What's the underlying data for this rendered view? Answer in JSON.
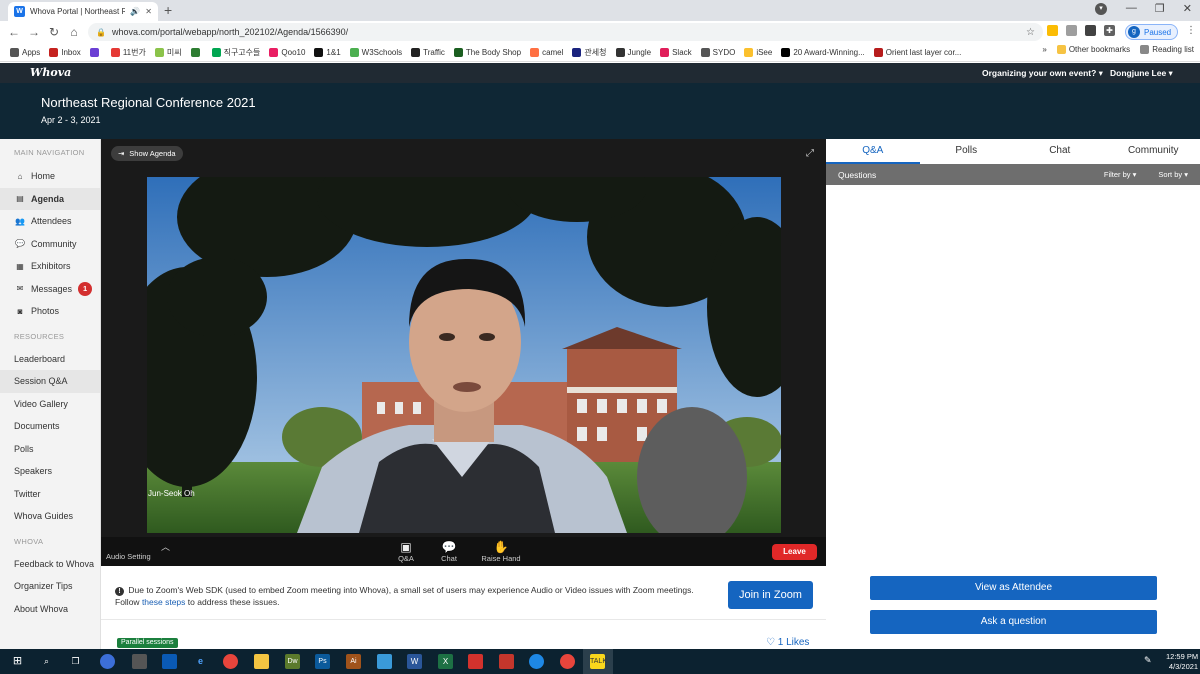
{
  "browser": {
    "tab_title": "Whova Portal | Northeast Regional Conference",
    "tab_favicon": "W",
    "url": "whova.com/portal/webapp/north_202102/Agenda/1566390/",
    "profile_initial": "g",
    "profile_status": "Paused",
    "bookmarks": [
      {
        "label": "Apps",
        "color": "#555"
      },
      {
        "label": "Inbox",
        "color": "#c5221f"
      },
      {
        "label": "",
        "color": "#6b3fd4"
      },
      {
        "label": "11번가",
        "color": "#e53935"
      },
      {
        "label": "미씨",
        "color": "#8bc34a"
      },
      {
        "label": "",
        "color": "#2e7d32"
      },
      {
        "label": "직구고수들",
        "color": "#00a651"
      },
      {
        "label": "Qoo10",
        "color": "#e91e63"
      },
      {
        "label": "1&1",
        "color": "#111"
      },
      {
        "label": "W3Schools",
        "color": "#4caf50"
      },
      {
        "label": "Traffic",
        "color": "#222"
      },
      {
        "label": "The Body Shop",
        "color": "#1b5e20"
      },
      {
        "label": "camel",
        "color": "#ff7043"
      },
      {
        "label": "관세청",
        "color": "#1a237e"
      },
      {
        "label": "Jungle",
        "color": "#333"
      },
      {
        "label": "Slack",
        "color": "#e01e5a"
      },
      {
        "label": "SYDO",
        "color": "#555"
      },
      {
        "label": "iSee",
        "color": "#fbc02d"
      },
      {
        "label": "20 Award-Winning...",
        "color": "#000"
      },
      {
        "label": "Orient last layer cor...",
        "color": "#b71c1c"
      }
    ],
    "bookmarks_overflow": "»",
    "other_bookmarks": "Other bookmarks",
    "reading_list": "Reading list"
  },
  "whova": {
    "logo": "Whova",
    "org_link": "Organizing your own event? ▾",
    "user_menu": "Dongjune Lee ▾"
  },
  "event": {
    "title": "Northeast Regional Conference 2021",
    "date": "Apr 2 - 3, 2021"
  },
  "sidebar": {
    "main_heading": "MAIN NAVIGATION",
    "main_items": [
      {
        "label": "Home",
        "icon": "home-icon",
        "glyph": "⌂"
      },
      {
        "label": "Agenda",
        "icon": "agenda-icon",
        "glyph": "▤"
      },
      {
        "label": "Attendees",
        "icon": "attendees-icon",
        "glyph": "👥"
      },
      {
        "label": "Community",
        "icon": "community-icon",
        "glyph": "💬"
      },
      {
        "label": "Exhibitors",
        "icon": "exhibitors-icon",
        "glyph": "▦"
      },
      {
        "label": "Messages",
        "icon": "messages-icon",
        "glyph": "✉",
        "badge": "1"
      },
      {
        "label": "Photos",
        "icon": "camera-icon",
        "glyph": "◙"
      }
    ],
    "resources_heading": "RESOURCES",
    "resources_items": [
      "Leaderboard",
      "Session Q&A",
      "Video Gallery",
      "Documents",
      "Polls",
      "Speakers",
      "Twitter",
      "Whova Guides"
    ],
    "whova_heading": "WHOVA",
    "whova_items": [
      "Feedback to Whova",
      "Organizer Tips",
      "About Whova"
    ]
  },
  "video": {
    "show_agenda": "Show Agenda",
    "speaker_name": "Jun-Seok Oh",
    "audio_setting": "Audio Setting",
    "controls": {
      "qa": "Q&A",
      "chat": "Chat",
      "raise_hand": "Raise Hand",
      "leave": "Leave"
    }
  },
  "notice": {
    "text_before": "Due to Zoom's Web SDK (used to embed Zoom meeting into Whova), a small set of users may experience Audio or Video issues with Zoom meetings. Follow ",
    "link": "these steps",
    "text_after": " to address these issues.",
    "join_button": "Join in Zoom"
  },
  "session": {
    "tag": "Parallel sessions",
    "likes": "♡ 1 Likes"
  },
  "right_panel": {
    "tabs": [
      "Q&A",
      "Polls",
      "Chat",
      "Community"
    ],
    "questions_label": "Questions",
    "filter_by": "Filter by ▾",
    "sort_by": "Sort by ▾",
    "view_as_attendee": "View as Attendee",
    "ask_question": "Ask a question"
  },
  "taskbar": {
    "time": "12:59 PM",
    "date": "4/3/2021"
  },
  "colors": {
    "accent": "#1565c0",
    "header_bg": "#0f2735",
    "leave_red": "#e02828",
    "tag_green": "#1b7f3d"
  }
}
